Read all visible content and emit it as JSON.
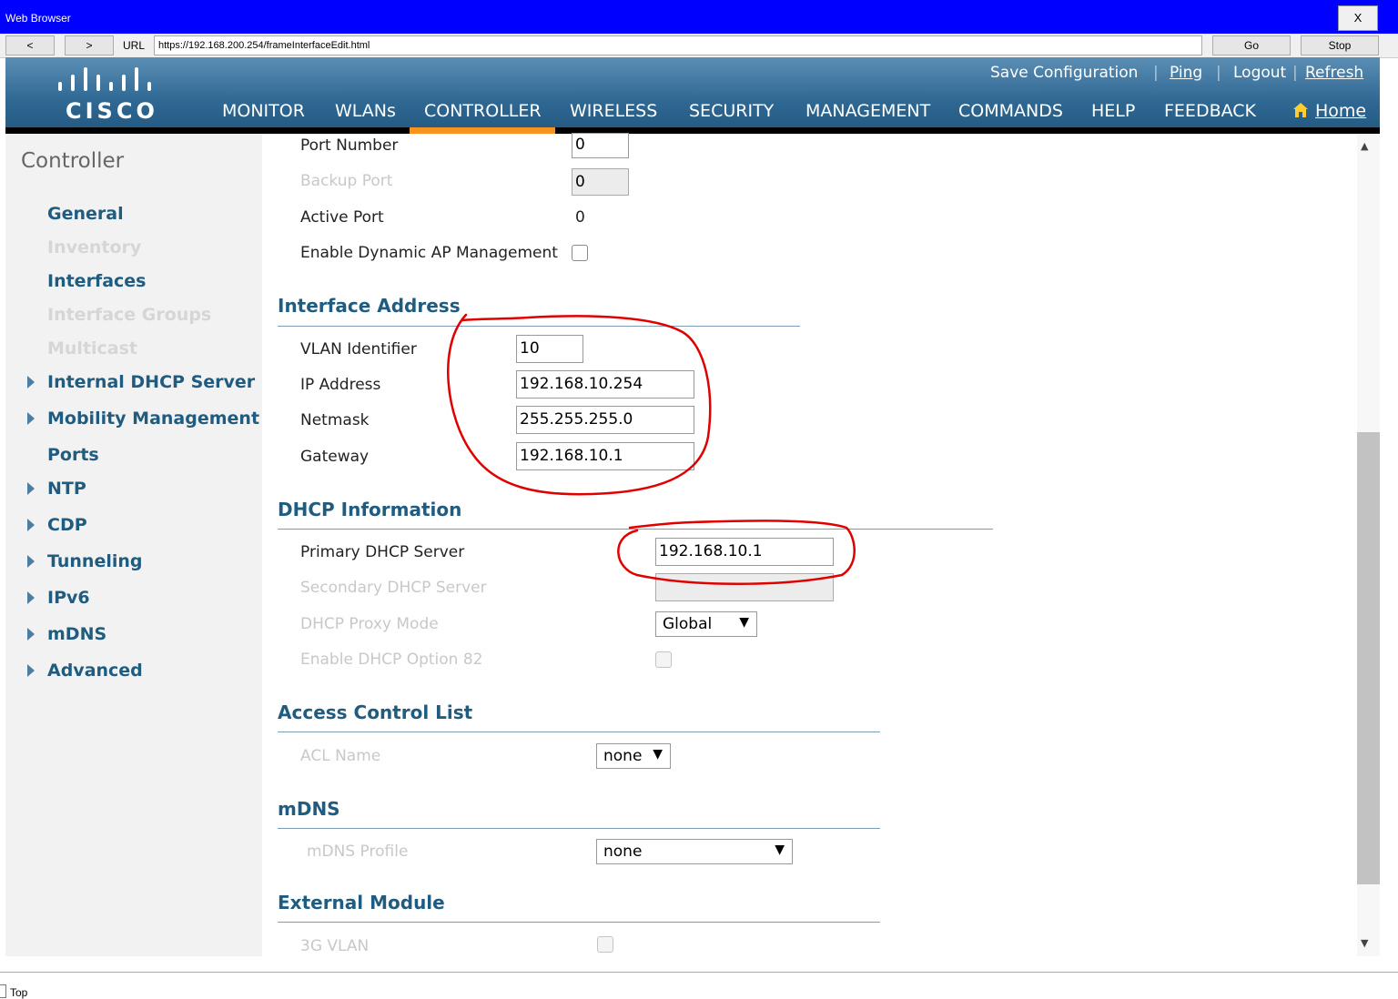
{
  "window": {
    "title": "Web Browser",
    "close_label": "X"
  },
  "browser": {
    "back_label": "<",
    "forward_label": ">",
    "url_label": "URL",
    "url": "https://192.168.200.254/frameInterfaceEdit.html",
    "go_label": "Go",
    "stop_label": "Stop"
  },
  "header": {
    "logo_text": "CISCO",
    "links": {
      "save": "Save Configuration",
      "ping": "Ping",
      "logout": "Logout",
      "refresh": "Refresh"
    },
    "menu": {
      "monitor": "MONITOR",
      "wlans": "WLANs",
      "controller": "CONTROLLER",
      "wireless": "WIRELESS",
      "security": "SECURITY",
      "management": "MANAGEMENT",
      "commands": "COMMANDS",
      "help": "HELP",
      "feedback": "FEEDBACK",
      "home": "Home"
    },
    "active_menu": "CONTROLLER",
    "accent_color": "#f7931e"
  },
  "sidebar": {
    "title": "Controller",
    "items": {
      "general": "General",
      "inventory": "Inventory",
      "interfaces": "Interfaces",
      "interface_groups": "Interface Groups",
      "multicast": "Multicast",
      "internal_dhcp": "Internal DHCP Server",
      "mobility": "Mobility Management",
      "ports": "Ports",
      "ntp": "NTP",
      "cdp": "CDP",
      "tunneling": "Tunneling",
      "ipv6": "IPv6",
      "mdns": "mDNS",
      "advanced": "Advanced"
    }
  },
  "port": {
    "port_number_label": "Port Number",
    "port_number_value": "0",
    "backup_port_label": "Backup Port",
    "backup_port_value": "0",
    "active_port_label": "Active Port",
    "active_port_value": "0",
    "dynamic_ap_label": "Enable Dynamic AP Management"
  },
  "interface_address": {
    "heading": "Interface Address",
    "vlan_label": "VLAN Identifier",
    "vlan_value": "10",
    "ip_label": "IP Address",
    "ip_value": "192.168.10.254",
    "netmask_label": "Netmask",
    "netmask_value": "255.255.255.0",
    "gateway_label": "Gateway",
    "gateway_value": "192.168.10.1"
  },
  "dhcp": {
    "heading": "DHCP Information",
    "primary_label": "Primary DHCP Server",
    "primary_value": "192.168.10.1",
    "secondary_label": "Secondary DHCP Server",
    "secondary_value": "",
    "proxy_label": "DHCP Proxy Mode",
    "proxy_value": "Global",
    "option82_label": "Enable DHCP Option 82"
  },
  "acl": {
    "heading": "Access Control List",
    "name_label": "ACL Name",
    "name_value": "none"
  },
  "mdns": {
    "heading": "mDNS",
    "profile_label": "mDNS Profile",
    "profile_value": "none"
  },
  "external": {
    "heading": "External Module",
    "vlan3g_label": "3G VLAN"
  },
  "status_bar": {
    "text": "Top"
  },
  "annotation_color": "#e00000"
}
